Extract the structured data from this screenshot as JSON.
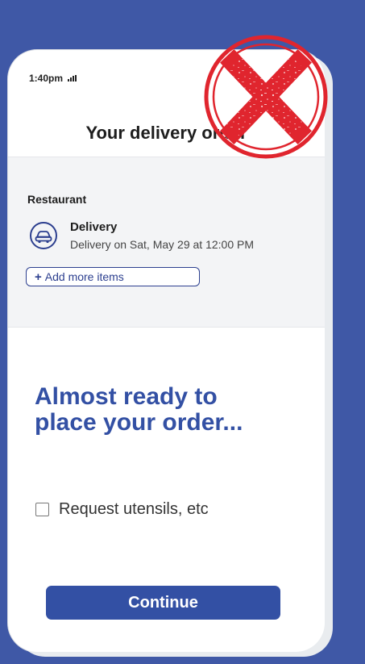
{
  "status_bar": {
    "time": "1:40pm"
  },
  "header": {
    "title": "Your delivery order"
  },
  "order": {
    "restaurant_label": "Restaurant",
    "delivery_title": "Delivery",
    "delivery_time": "Delivery on Sat, May 29 at 12:00 PM",
    "add_items_label": "Add more items",
    "add_items_icon": "plus-icon",
    "mode_icon": "car-icon"
  },
  "main": {
    "headline_line1": "Almost ready to",
    "headline_line2": "place your order...",
    "utensils_label": "Request utensils, etc",
    "utensils_checked": false,
    "continue_label": "Continue"
  },
  "overlay": {
    "icon": "rejected-x-stamp-icon",
    "color": "#e0252e"
  },
  "colors": {
    "background": "#3f58a6",
    "accent": "#3350a4",
    "panel": "#f3f4f6"
  }
}
